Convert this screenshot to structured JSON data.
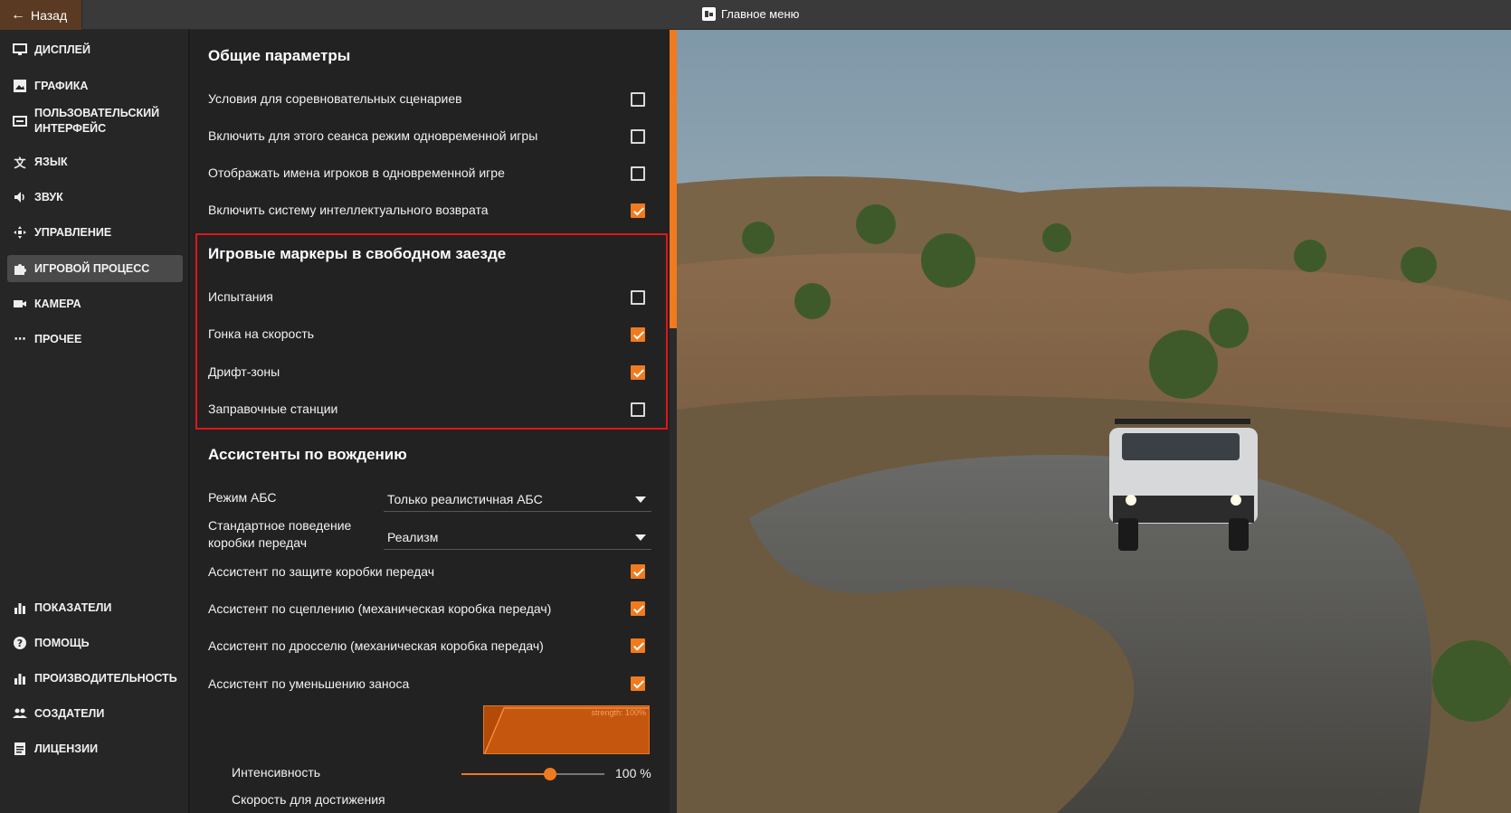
{
  "topbar": {
    "back_label": "Назад",
    "title": "Главное меню"
  },
  "sidebar": {
    "items": [
      {
        "label": "ДИСПЛЕЙ",
        "icon": "monitor-icon"
      },
      {
        "label": "ГРАФИКА",
        "icon": "image-icon"
      },
      {
        "label": "ПОЛЬЗОВАТЕЛЬСКИЙ ИНТЕРФЕЙС",
        "icon": "interface-icon"
      },
      {
        "label": "ЯЗЫК",
        "icon": "translate-icon"
      },
      {
        "label": "ЗВУК",
        "icon": "speaker-icon"
      },
      {
        "label": "УПРАВЛЕНИЕ",
        "icon": "gamepad-icon"
      },
      {
        "label": "ИГРОВОЙ ПРОЦЕСС",
        "icon": "puzzle-icon",
        "active": true
      },
      {
        "label": "КАМЕРА",
        "icon": "camera-icon"
      },
      {
        "label": "ПРОЧЕЕ",
        "icon": "more-icon"
      }
    ],
    "bottom_items": [
      {
        "label": "ПОКАЗАТЕЛИ",
        "icon": "bar-chart-icon"
      },
      {
        "label": "ПОМОЩЬ",
        "icon": "help-icon"
      },
      {
        "label": "ПРОИЗВОДИТЕЛЬНОСТЬ",
        "icon": "performance-icon"
      },
      {
        "label": "СОЗДАТЕЛИ",
        "icon": "people-icon"
      },
      {
        "label": "ЛИЦЕНЗИИ",
        "icon": "license-icon"
      }
    ]
  },
  "settings": {
    "general": {
      "title": "Общие параметры",
      "options": [
        {
          "label": "Условия для соревновательных сценариев",
          "checked": false
        },
        {
          "label": "Включить для этого сеанса режим одновременной игры",
          "checked": false
        },
        {
          "label": "Отображать имена игроков в одновременной игре",
          "checked": false
        },
        {
          "label": "Включить систему интеллектуального возврата",
          "checked": true
        }
      ]
    },
    "markers": {
      "title": "Игровые маркеры в свободном заезде",
      "options": [
        {
          "label": "Испытания",
          "checked": false
        },
        {
          "label": "Гонка на скорость",
          "checked": true
        },
        {
          "label": "Дрифт-зоны",
          "checked": true
        },
        {
          "label": "Заправочные станции",
          "checked": false
        }
      ]
    },
    "assists": {
      "title": "Ассистенты по вождению",
      "abs_label": "Режим АБС",
      "abs_value": "Только реалистичная АБС",
      "gearbox_label": "Стандартное поведение коробки передач",
      "gearbox_value": "Реализм",
      "options": [
        {
          "label": "Ассистент по защите коробки передач",
          "checked": true
        },
        {
          "label": "Ассистент по сцеплению (механическая коробка передач)",
          "checked": true
        },
        {
          "label": "Ассистент по дросселю (механическая коробка передач)",
          "checked": true
        },
        {
          "label": "Ассистент по уменьшению заноса",
          "checked": true
        }
      ],
      "graph_label": "strength: 100%",
      "intensity_label": "Интенсивность",
      "intensity_value": "100 %",
      "intensity_fraction": 0.62,
      "speed_label": "Скорость для достижения"
    }
  },
  "colors": {
    "accent": "#f07a1e",
    "highlight_box": "#e0151b"
  }
}
